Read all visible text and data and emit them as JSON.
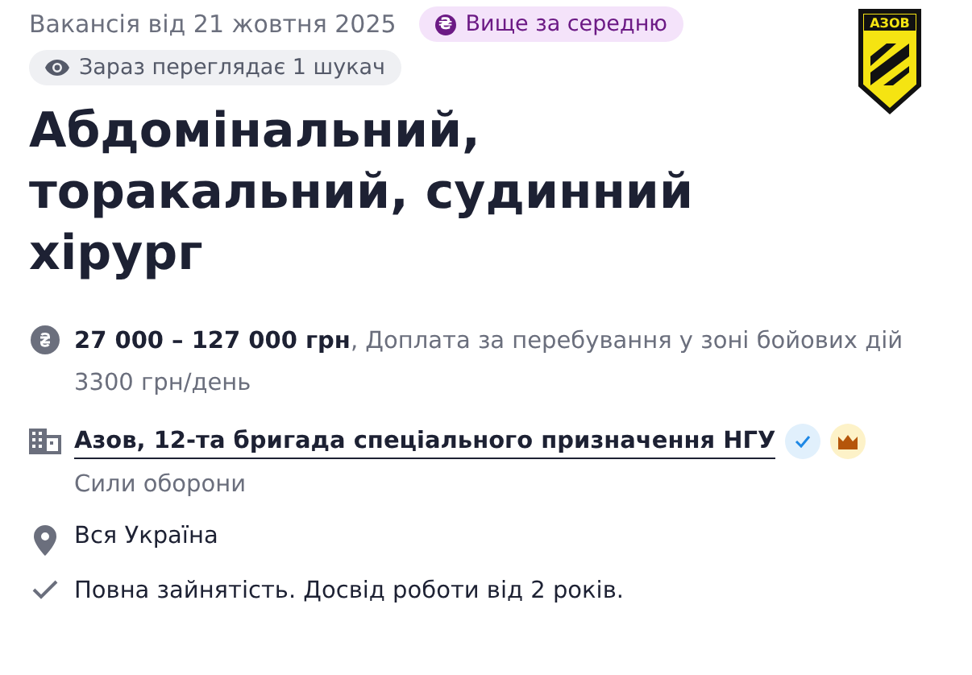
{
  "posted": "Вакансія від 21 жовтня 2025",
  "salary_badge": {
    "icon": "₴",
    "label": "Вище за середню"
  },
  "viewers": "Зараз переглядає 1 шукач",
  "logo_text": "АЗОВ",
  "title": "Абдомінальний, торакальний, судинний хірург",
  "details": [
    {
      "kind": "salary",
      "text": "**27 000 – 127 000 грн**, Доплата за перебування у зоні бойових дій 3300 грн/день"
    },
    {
      "kind": "company",
      "text": "Азов, 12-та бригада спеціального призначення НГУ",
      "verified": true,
      "premium": true,
      "sub": "Сили оборони"
    },
    {
      "kind": "location",
      "text": "Вся Україна"
    },
    {
      "kind": "terms",
      "text": "Повна зайнятість. Досвід роботи від 2 років."
    }
  ]
}
